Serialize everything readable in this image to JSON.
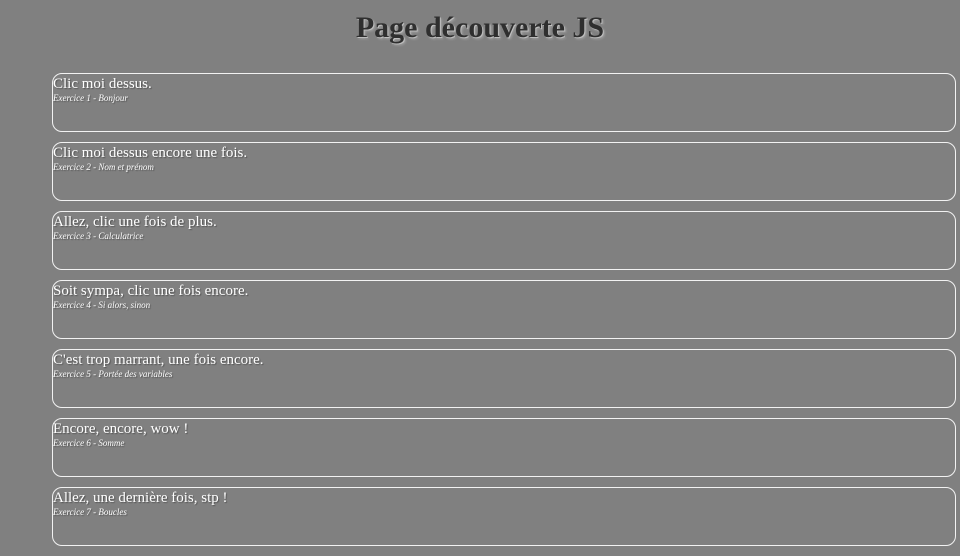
{
  "page": {
    "title": "Page découverte JS"
  },
  "exercises": [
    {
      "label": "Clic moi dessus.",
      "subtitle": "Exercice 1 - Bonjour"
    },
    {
      "label": "Clic moi dessus encore une fois.",
      "subtitle": "Exercice 2 - Nom et prénom"
    },
    {
      "label": "Allez, clic une fois de plus.",
      "subtitle": "Exercice 3 - Calculatrice"
    },
    {
      "label": "Soit sympa, clic une fois encore.",
      "subtitle": "Exercice 4 - Si alors, sinon"
    },
    {
      "label": "C'est trop marrant, une fois encore.",
      "subtitle": "Exercice 5 - Portée des variables"
    },
    {
      "label": "Encore, encore, wow !",
      "subtitle": "Exercice 6 - Somme"
    },
    {
      "label": "Allez, une dernière fois, stp !",
      "subtitle": "Exercice 7 - Boucles"
    }
  ],
  "colors": {
    "background": "#808080",
    "title": "#2f2f2f",
    "card_border": "#f2f2f2",
    "text": "#ffffff"
  }
}
